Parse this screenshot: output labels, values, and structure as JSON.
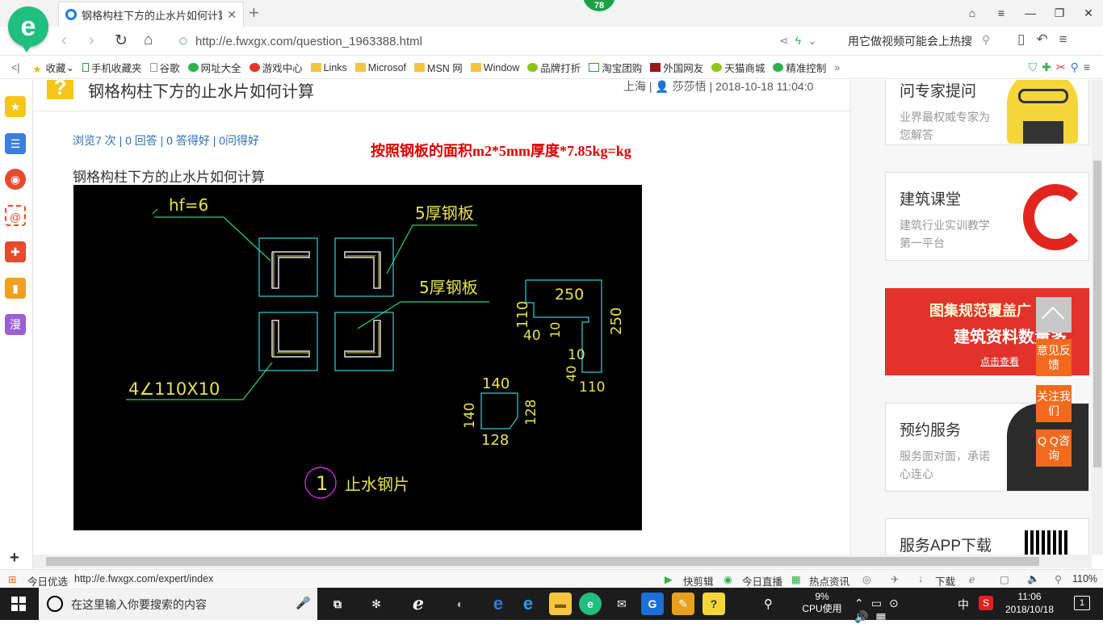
{
  "browser": {
    "tab_title": "钢格构柱下方的止水片如何计算_",
    "tab_close": "✕",
    "new_tab": "+",
    "badge": "78",
    "url": "http://e.fwxgx.com/question_1963388.html",
    "search_hint": "用它做视频可能会上热搜"
  },
  "bookmarks": [
    {
      "label": "收藏",
      "icon": "star-icon"
    },
    {
      "label": "手机收藏夹",
      "icon": "phone-icon"
    },
    {
      "label": "谷歌",
      "icon": "page-icon"
    },
    {
      "label": "网址大全",
      "icon": "globe-icon"
    },
    {
      "label": "游戏中心",
      "icon": "game-icon"
    },
    {
      "label": "Links",
      "icon": "folder-icon"
    },
    {
      "label": "Microsof",
      "icon": "folder-icon"
    },
    {
      "label": "MSN 网",
      "icon": "folder-icon"
    },
    {
      "label": "Window",
      "icon": "folder-icon"
    },
    {
      "label": "品牌打折",
      "icon": "leaf-icon"
    },
    {
      "label": "淘宝团购",
      "icon": "cart-icon"
    },
    {
      "label": "外国网友",
      "icon": "bookmark-icon"
    },
    {
      "label": "天猫商城",
      "icon": "leaf-icon"
    },
    {
      "label": "精准控制",
      "icon": "chat-icon"
    }
  ],
  "question": {
    "title": "钢格构柱下方的止水片如何计算",
    "location": "上海",
    "author": "莎莎悟",
    "datetime": "2018-10-18 11:04:0",
    "stats": "浏览7 次 | 0 回答 | 0 答得好 | 0问得好",
    "answer_formula": "按照钢板的面积m2*5mm厚度*7.85kg=kg",
    "body": "钢格构柱下方的止水片如何计算"
  },
  "drawing": {
    "weld": "hf=6",
    "plate1": "5厚钢板",
    "plate2": "5厚钢板",
    "angle": "4∠110X10",
    "dim_250_top": "250",
    "dim_250_right": "250",
    "dim_110_left": "110",
    "dim_40_a": "40",
    "dim_10_a": "10",
    "dim_10_b": "10",
    "dim_40_b": "40",
    "dim_110_bottom": "110",
    "dim_140_top": "140",
    "dim_140_left": "140",
    "dim_128_right": "128",
    "dim_128_bottom": "128",
    "detail_no": "1",
    "detail_title": "止水钢片"
  },
  "sidebar_right": {
    "ask_title": "问专家提问",
    "ask_sub": "业界最权威专家为您解答",
    "class_title": "建筑课堂",
    "class_sub": "建筑行业实训教学第一平台",
    "banner_line1": "图集规范覆盖广",
    "banner_line2": "建筑资料数量多",
    "banner_cta": "点击查看",
    "service_title": "预约服务",
    "service_sub": "服务面对面，承诺心连心",
    "app_title": "服务APP下载"
  },
  "float_buttons": {
    "feedback": "意见反馈",
    "follow": "关注我们",
    "qq": "Q Q咨询"
  },
  "statusbar": {
    "today": "今日优选",
    "link": "http://e.fwxgx.com/expert/index",
    "clip": "快剪辑",
    "live": "今日直播",
    "news": "热点资讯",
    "download": "下载",
    "zoom": "110%"
  },
  "taskbar": {
    "search_placeholder": "在这里输入你要搜索的内容",
    "cpu_value": "9%",
    "cpu_label": "CPU使用",
    "ime": "中",
    "time": "11:06",
    "date": "2018/10/18",
    "notifications": "1"
  }
}
